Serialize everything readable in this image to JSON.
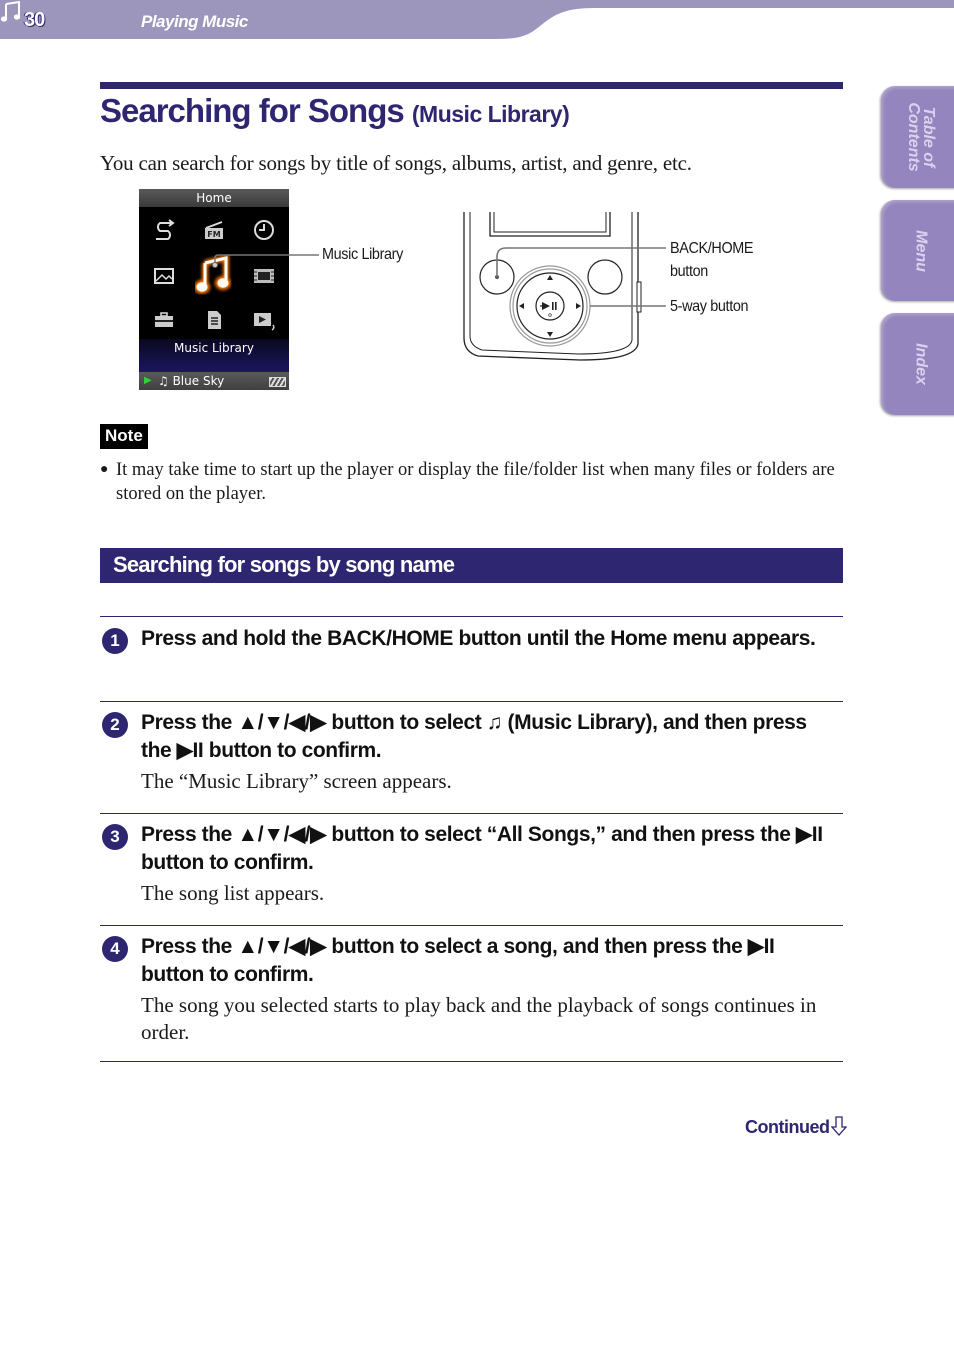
{
  "header": {
    "page_number": "30",
    "section_icon": "music-note-icon",
    "section_title": "Playing Music",
    "band_color": "#9c95bc"
  },
  "side_tabs": [
    {
      "label": "Table of\nContents"
    },
    {
      "label": "Menu"
    },
    {
      "label": "Index"
    }
  ],
  "title": {
    "main": "Searching for Songs",
    "sub": "(Music Library)",
    "color": "#2e2670"
  },
  "intro": "You can search for songs by title of songs, albums, artist, and genre, etc.",
  "figure": {
    "screen": {
      "header": "Home",
      "selected_label": "Music Library",
      "now_playing": "Blue Sky",
      "icons": [
        "repeat-icon",
        "fm-radio-icon",
        "clock-icon",
        "photo-icon",
        "music-library-icon",
        "video-icon",
        "toolbox-icon",
        "document-list-icon",
        "now-playing-icon"
      ]
    },
    "callouts": {
      "music_library": "Music Library",
      "back_home": "BACK/HOME\nbutton",
      "five_way": "5-way button"
    }
  },
  "note": {
    "label": "Note",
    "items": [
      "It may take time to start up the player or display the file/folder list when many files or folders are stored on the player."
    ]
  },
  "section": {
    "title": "Searching for songs by song name"
  },
  "steps": [
    {
      "number": "1",
      "head": "Press and hold the BACK/HOME button until the Home menu appears.",
      "body": ""
    },
    {
      "number": "2",
      "head": "Press the ▲/▼/◀/▶ button to select ♫ (Music Library), and then press the ▶II button to confirm.",
      "body": "The “Music Library” screen appears."
    },
    {
      "number": "3",
      "head": "Press the ▲/▼/◀/▶ button to select “All Songs,” and then press the ▶II button to confirm.",
      "body": "The song list appears."
    },
    {
      "number": "4",
      "head": "Press the ▲/▼/◀/▶ button to select a song, and then press the ▶II button to confirm.",
      "body": "The song you selected starts to play back and the playback of songs continues in order."
    }
  ],
  "footer": {
    "continued": "Continued"
  }
}
